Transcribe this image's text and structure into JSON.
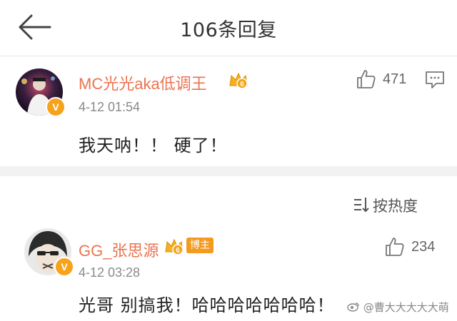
{
  "header": {
    "title": "106条回复"
  },
  "comments": [
    {
      "username": "MC光光aka低调王",
      "crown_level": "6",
      "verified_badge": "V",
      "time": "4-12 01:54",
      "content": "我天呐！！ 硬了！",
      "likes": "471"
    },
    {
      "username": "GG_张思源",
      "crown_level": "6",
      "verified_badge": "V",
      "tag": "博主",
      "time": "4-12 03:28",
      "content": "光哥 别搞我！哈哈哈哈哈哈哈！",
      "likes": "234"
    }
  ],
  "sort": {
    "label": "按热度",
    "icon": "sort-icon"
  },
  "watermark": "@曹大大大大大萌",
  "icons": {
    "back": "arrow-left-icon",
    "like": "thumbs-up-icon",
    "reply": "comment-bubble-icon",
    "crown": "vip-crown-icon"
  },
  "colors": {
    "username": "#eb7350",
    "badge": "#f6a31b",
    "divider": "#f2f2f2"
  }
}
